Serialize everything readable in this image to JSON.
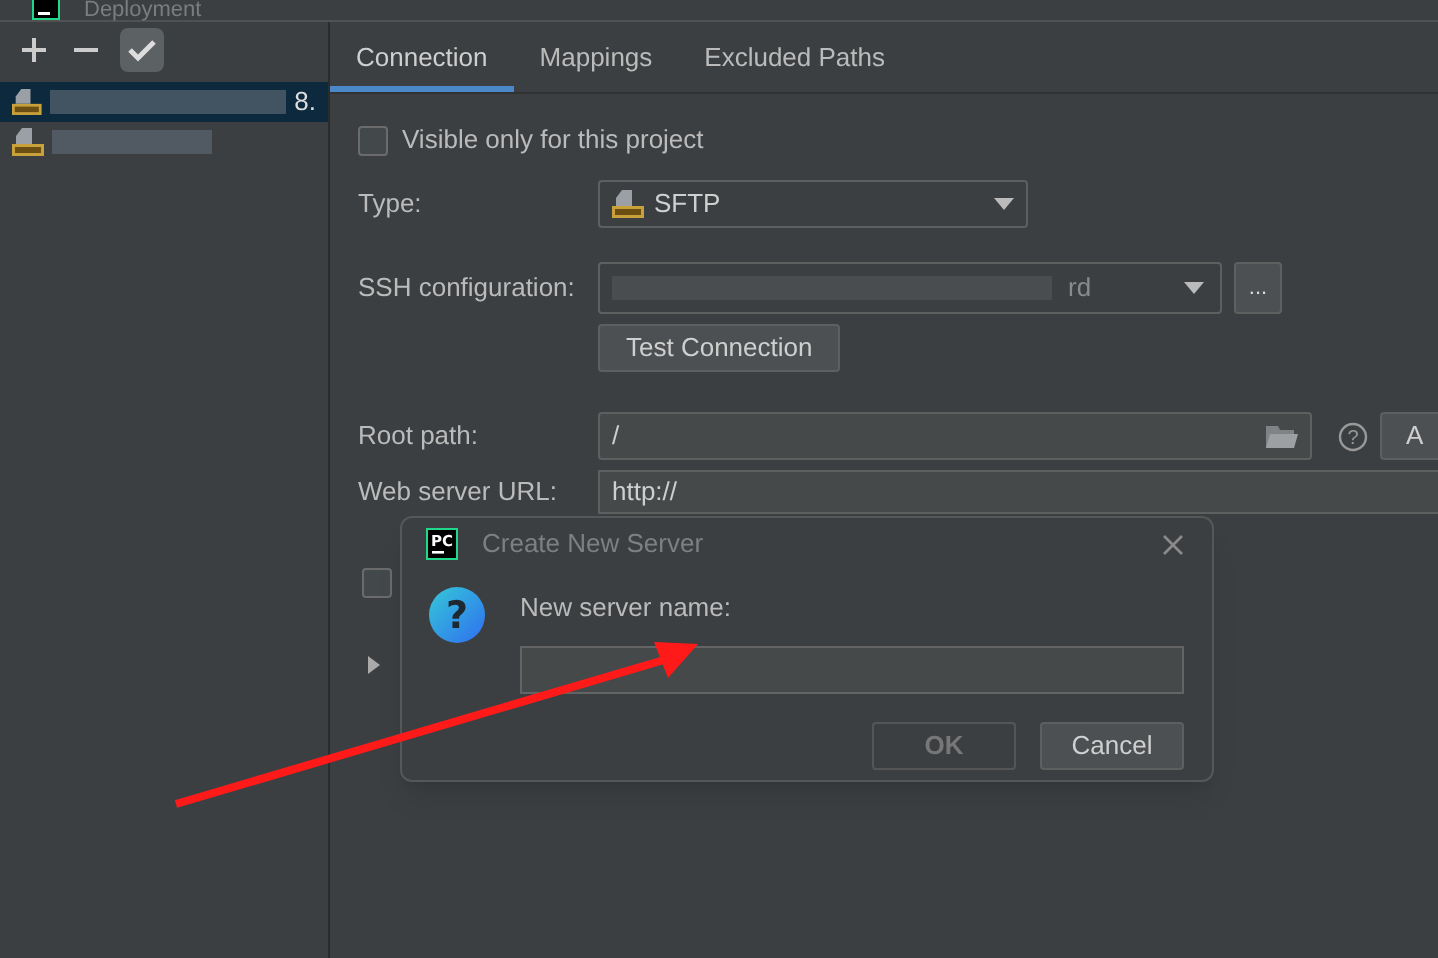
{
  "window": {
    "title": "Deployment"
  },
  "servers": [
    {
      "selected": true,
      "name_tail": "8."
    },
    {
      "selected": false
    }
  ],
  "tabs": [
    {
      "label": "Connection",
      "selected": true
    },
    {
      "label": "Mappings",
      "selected": false
    },
    {
      "label": "Excluded Paths",
      "selected": false
    }
  ],
  "visible_only": {
    "label": "Visible only for this project",
    "checked": false
  },
  "type": {
    "label": "Type:",
    "value": "SFTP"
  },
  "ssh": {
    "label": "SSH configuration:",
    "value": "rd",
    "browse": "..."
  },
  "test_button": "Test Connection",
  "root_path": {
    "label": "Root path:",
    "value": "/",
    "side_button": "A",
    "help_glyph": "?"
  },
  "web_url": {
    "label": "Web server URL:",
    "value": "http://"
  },
  "option_checkbox": {
    "checked": false
  },
  "dialog": {
    "logo_text": "PC",
    "question_glyph": "?",
    "title": "Create New Server",
    "prompt": "New server name:",
    "buttons": [
      {
        "label": "OK",
        "disabled": true
      },
      {
        "label": "Cancel",
        "disabled": false
      }
    ]
  }
}
